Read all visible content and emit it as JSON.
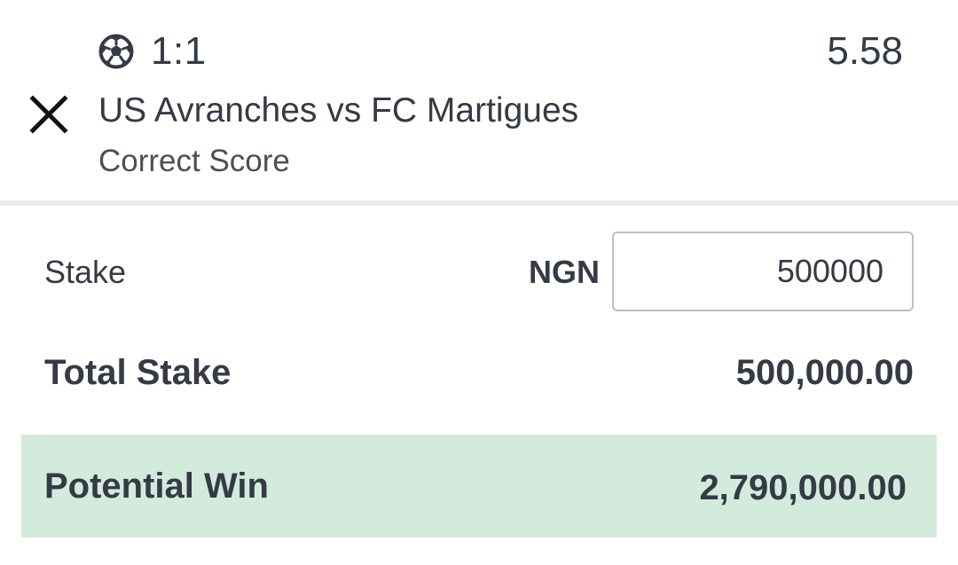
{
  "selection": {
    "score": "1:1",
    "odds": "5.58",
    "match": "US Avranches vs FC Martigues",
    "market": "Correct Score",
    "icon": "soccer-ball-icon",
    "remove_icon": "close-icon"
  },
  "stake": {
    "label": "Stake",
    "currency": "NGN",
    "value": "500000"
  },
  "totals": {
    "total_stake_label": "Total Stake",
    "total_stake_value": "500,000.00",
    "potential_win_label": "Potential Win",
    "potential_win_value": "2,790,000.00"
  },
  "colors": {
    "text": "#353a45",
    "win_panel": "#d2ebdd",
    "divider": "#e9ecef",
    "input_border": "#bdc0c4"
  }
}
